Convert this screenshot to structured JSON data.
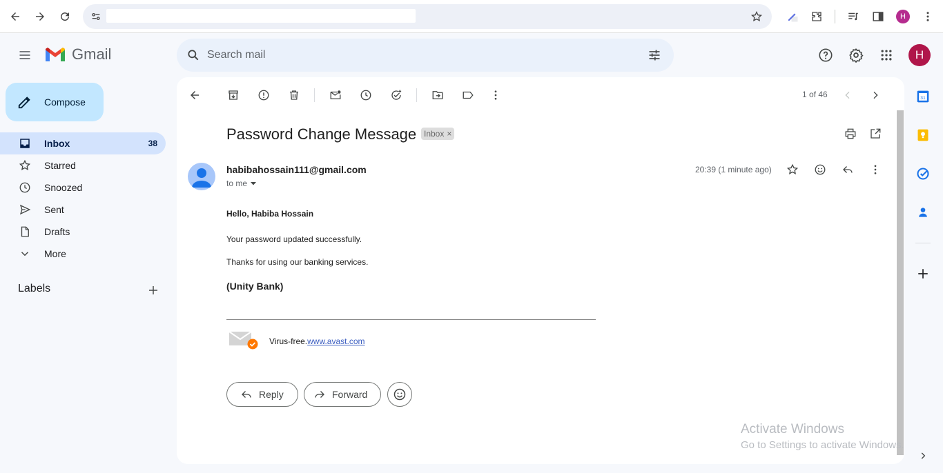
{
  "browser": {
    "url": "",
    "profile_initial": "H"
  },
  "app": {
    "name": "Gmail"
  },
  "search": {
    "placeholder": "Search mail"
  },
  "header": {
    "avatar_initial": "H"
  },
  "sidebar": {
    "compose_label": "Compose",
    "items": [
      {
        "label": "Inbox",
        "count": "38",
        "icon": "inbox-icon"
      },
      {
        "label": "Starred",
        "count": "",
        "icon": "star-icon"
      },
      {
        "label": "Snoozed",
        "count": "",
        "icon": "clock-icon"
      },
      {
        "label": "Sent",
        "count": "",
        "icon": "send-icon"
      },
      {
        "label": "Drafts",
        "count": "",
        "icon": "draft-icon"
      },
      {
        "label": "More",
        "count": "",
        "icon": "chevron-down-icon"
      }
    ],
    "labels_heading": "Labels"
  },
  "toolbar": {
    "pager": "1 of 46"
  },
  "email": {
    "subject": "Password Change Message",
    "chip": "Inbox",
    "chip_remove": "×",
    "sender": "habibahossain111@gmail.com",
    "to": "to me",
    "time": "20:39 (1 minute ago)",
    "greeting": "Hello, Habiba Hossain",
    "line1": "Your password updated successfully.",
    "line2": "Thanks for using our banking services.",
    "signature": "(Unity Bank)",
    "virus_free": "Virus-free.",
    "avast_link": "www.avast.com"
  },
  "actions": {
    "reply": "Reply",
    "forward": "Forward"
  },
  "watermark": {
    "line1": "Activate Windows",
    "line2": "Go to Settings to activate Windows."
  },
  "colors": {
    "accent": "#0b57d0",
    "compose_bg": "#c2e7ff",
    "active_nav": "#d3e3fd",
    "avatar": "#b0164a"
  }
}
